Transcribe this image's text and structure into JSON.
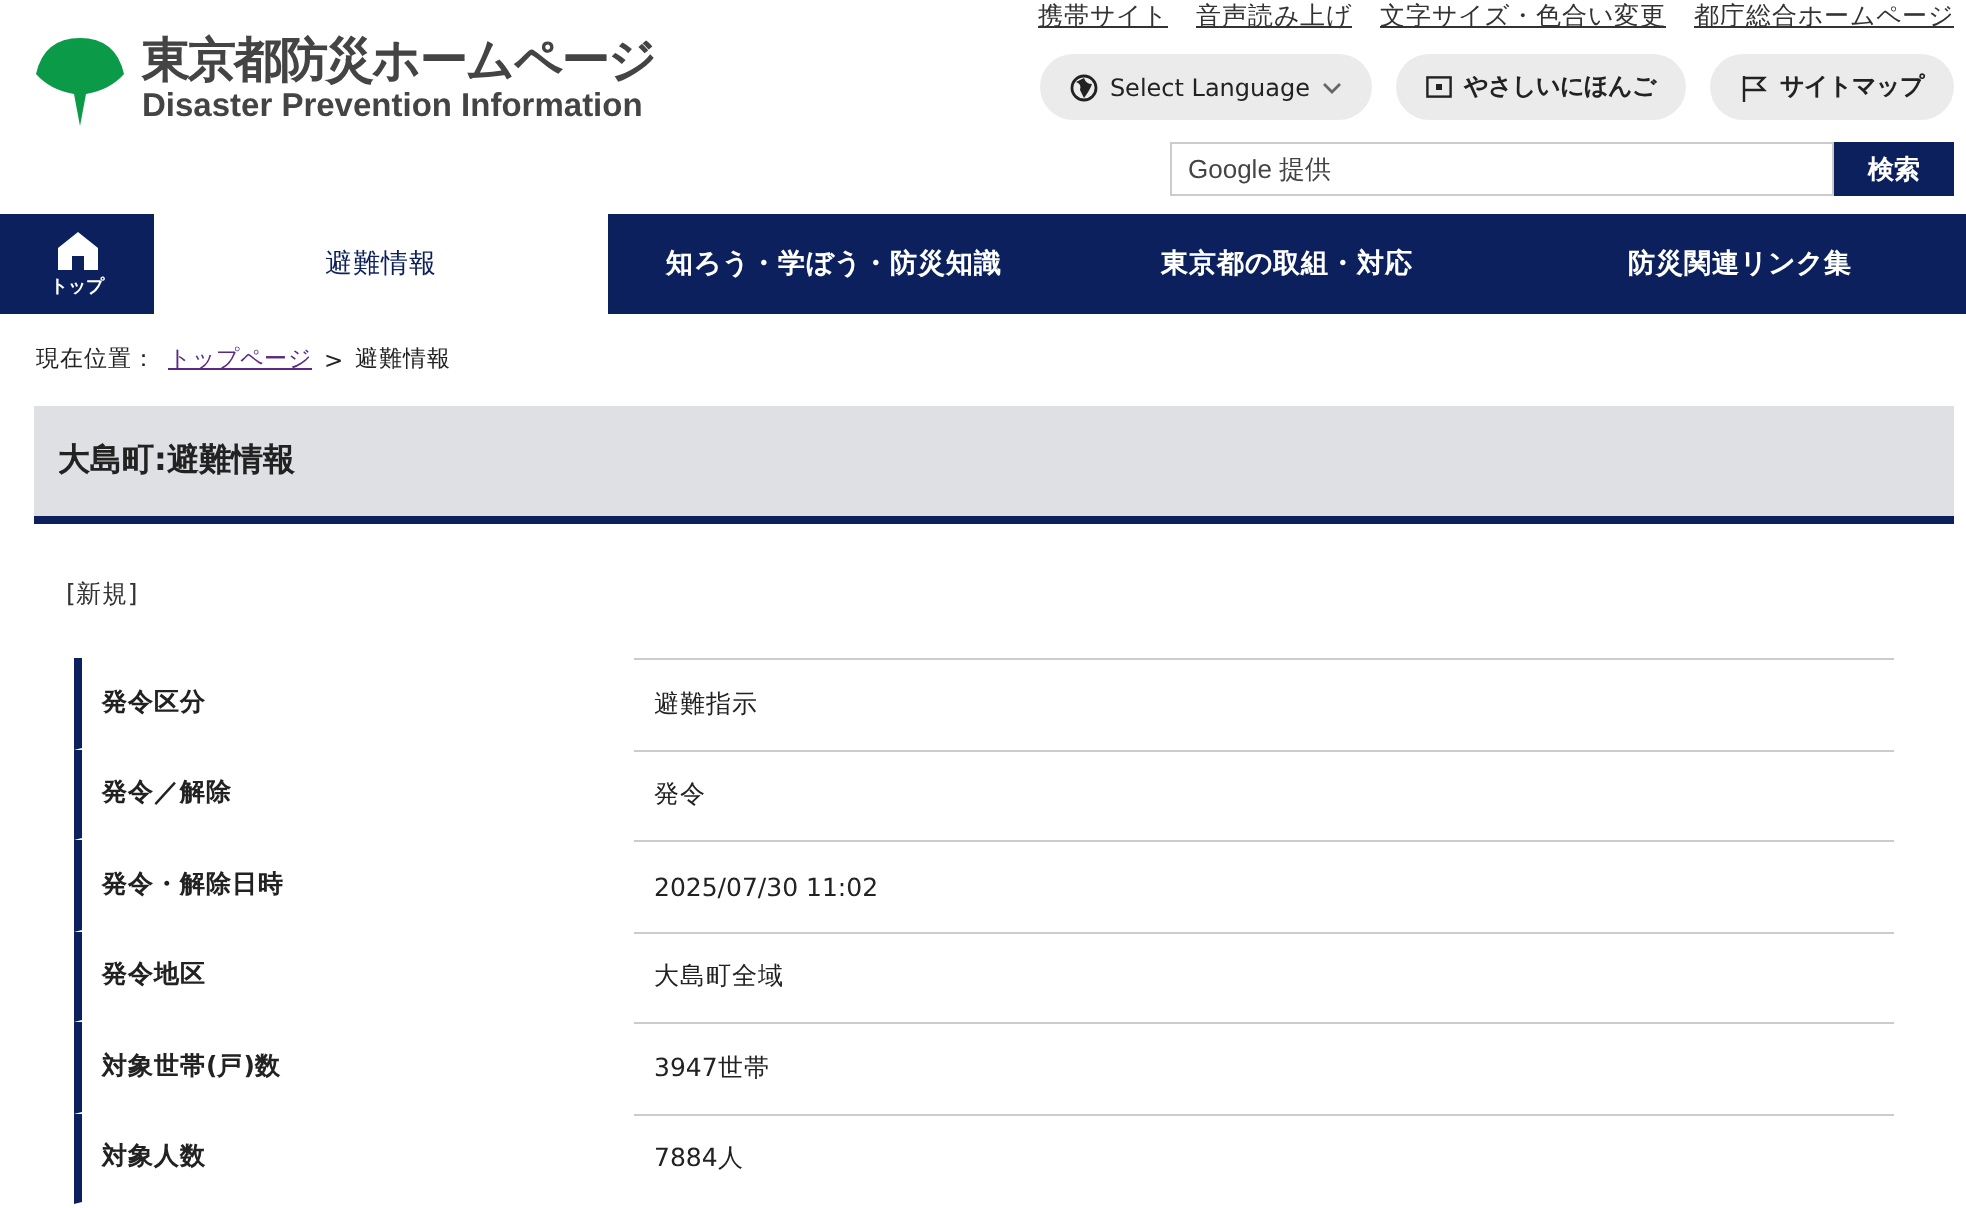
{
  "header": {
    "logo_title": "東京都防災ホームページ",
    "logo_subtitle": "Disaster Prevention Information",
    "utility_links": [
      "携帯サイト",
      "音声読み上げ",
      "文字サイズ・色合い変更",
      "都庁総合ホームページ"
    ],
    "language_button": "Select Language",
    "easy_japanese_button": "やさしいにほんご",
    "sitemap_button": "サイトマップ",
    "search": {
      "placeholder": "Google 提供",
      "button": "検索"
    }
  },
  "nav": {
    "home_label": "トップ",
    "tabs": [
      {
        "label": "避難情報",
        "selected": true
      },
      {
        "label": "知ろう・学ぼう・防災知識",
        "selected": false
      },
      {
        "label": "東京都の取組・対応",
        "selected": false
      },
      {
        "label": "防災関連リンク集",
        "selected": false
      }
    ]
  },
  "breadcrumb": {
    "prefix": "現在位置：",
    "link": "トップページ",
    "separator": ">",
    "current": "避難情報"
  },
  "heading": "大島町:避難情報",
  "status": "[新規]",
  "table": {
    "rows": [
      {
        "label": "発令区分",
        "value": "避難指示"
      },
      {
        "label": "発令／解除",
        "value": "発令"
      },
      {
        "label": "発令・解除日時",
        "value": "2025/07/30 11:02"
      },
      {
        "label": "発令地区",
        "value": "大島町全域"
      },
      {
        "label": "対象世帯(戸)数",
        "value": "3947世帯"
      },
      {
        "label": "対象人数",
        "value": "7884人"
      }
    ]
  }
}
